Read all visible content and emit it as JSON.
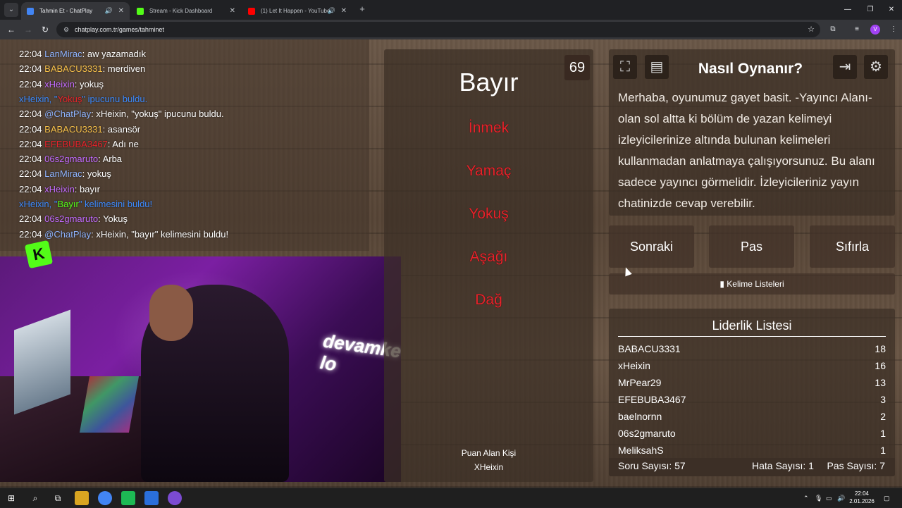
{
  "browser": {
    "tabs": [
      {
        "label": "Tahmin Et - ChatPlay",
        "active": true,
        "favicon_color": "#4285f4"
      },
      {
        "label": "Stream - Kick Dashboard",
        "active": false,
        "favicon_color": "#53fc18"
      },
      {
        "label": "(1) Let It Happen - YouTube",
        "active": false,
        "favicon_color": "#ff0000"
      }
    ],
    "url": "chatplay.com.tr/games/tahminet",
    "profile_initial": "V"
  },
  "chat": {
    "messages": [
      {
        "time": "22:04",
        "user": "LanMirac",
        "user_color": "#8fb4ff",
        "sep": ": ",
        "text": "aw yazamadık"
      },
      {
        "time": "22:04",
        "user": "BABACU3331",
        "user_color": "#f6c04a",
        "sep": ": ",
        "text": "merdiven"
      },
      {
        "time": "22:04",
        "user": "xHeixin",
        "user_color": "#c36bff",
        "sep": ": ",
        "text": "yokuş"
      },
      {
        "time": "",
        "user": "xHeixin, \"",
        "user_color": "#3d8bff",
        "sep": "",
        "highlight": "Yokuş",
        "highlight_color": "#e8232b",
        "text": "\" ipucunu buldu.",
        "text_color": "#3d8bff"
      },
      {
        "time": "22:04",
        "user": "@ChatPlay",
        "user_color": "#8fb4ff",
        "sep": ": ",
        "text": "xHeixin, \"yokuş\" ipucunu buldu."
      },
      {
        "time": "22:04",
        "user": "BABACU3331",
        "user_color": "#f6c04a",
        "sep": ": ",
        "text": "asansör"
      },
      {
        "time": "22:04",
        "user": "EFEBUBA3467",
        "user_color": "#e8232b",
        "sep": ": ",
        "text": "Adı ne"
      },
      {
        "time": "22:04",
        "user": "06s2gmaruto",
        "user_color": "#c36bff",
        "sep": ": ",
        "text": "Arba"
      },
      {
        "time": "22:04",
        "user": "LanMirac",
        "user_color": "#8fb4ff",
        "sep": ": ",
        "text": "yokuş"
      },
      {
        "time": "22:04",
        "user": "xHeixin",
        "user_color": "#c36bff",
        "sep": ": ",
        "text": "bayır"
      },
      {
        "time": "",
        "user": "xHeixin, \"",
        "user_color": "#3d8bff",
        "sep": "",
        "highlight": "Bayır",
        "highlight_color": "#53fc18",
        "text": "\" kelimesini buldu!",
        "text_color": "#3d8bff"
      },
      {
        "time": "22:04",
        "user": "06s2gmaruto",
        "user_color": "#c36bff",
        "sep": ": ",
        "text": "Yokuş"
      },
      {
        "time": "22:04",
        "user": "@ChatPlay",
        "user_color": "#8fb4ff",
        "sep": ": ",
        "text": "xHeixin, \"bayır\" kelimesini buldu!"
      }
    ]
  },
  "webcam": {
    "sign_text": "devamke lo"
  },
  "game": {
    "word": "Bayır",
    "counter": "69",
    "forbidden_words": [
      "İnmek",
      "Yamaç",
      "Yokuş",
      "Aşağı",
      "Dağ"
    ],
    "scorer_label": "Puan Alan Kişi",
    "scorer_name": "XHeixin"
  },
  "howto": {
    "title": "Nasıl Oynanır?",
    "text": "Merhaba, oyunumuz gayet basit. -Yayıncı Alanı- olan sol altta ki bölüm de yazan kelimeyi izleyicilerinize altında bulunan kelimeleri kullanmadan anlatmaya çalışıyorsunuz. Bu alanı sadece yayıncı görmelidir. İzleyicileriniz yayın chatinizde cevap verebilir."
  },
  "actions": {
    "next": "Sonraki",
    "pass": "Pas",
    "reset": "Sıfırla",
    "word_lists": "Kelime Listeleri"
  },
  "leaderboard": {
    "title": "Liderlik Listesi",
    "rows": [
      {
        "name": "BABACU3331",
        "score": "18"
      },
      {
        "name": "xHeixin",
        "score": "16"
      },
      {
        "name": "MrPear29",
        "score": "13"
      },
      {
        "name": "EFEBUBA3467",
        "score": "3"
      },
      {
        "name": "baelnornn",
        "score": "2"
      },
      {
        "name": "06s2gmaruto",
        "score": "1"
      },
      {
        "name": "MeliksahS",
        "score": "1"
      }
    ],
    "question_count": "Soru Sayısı: 57",
    "error_count": "Hata Sayısı: 1",
    "pass_count": "Pas Sayısı: 7"
  },
  "taskbar": {
    "time": "22:04",
    "date": "2.01.2026"
  }
}
